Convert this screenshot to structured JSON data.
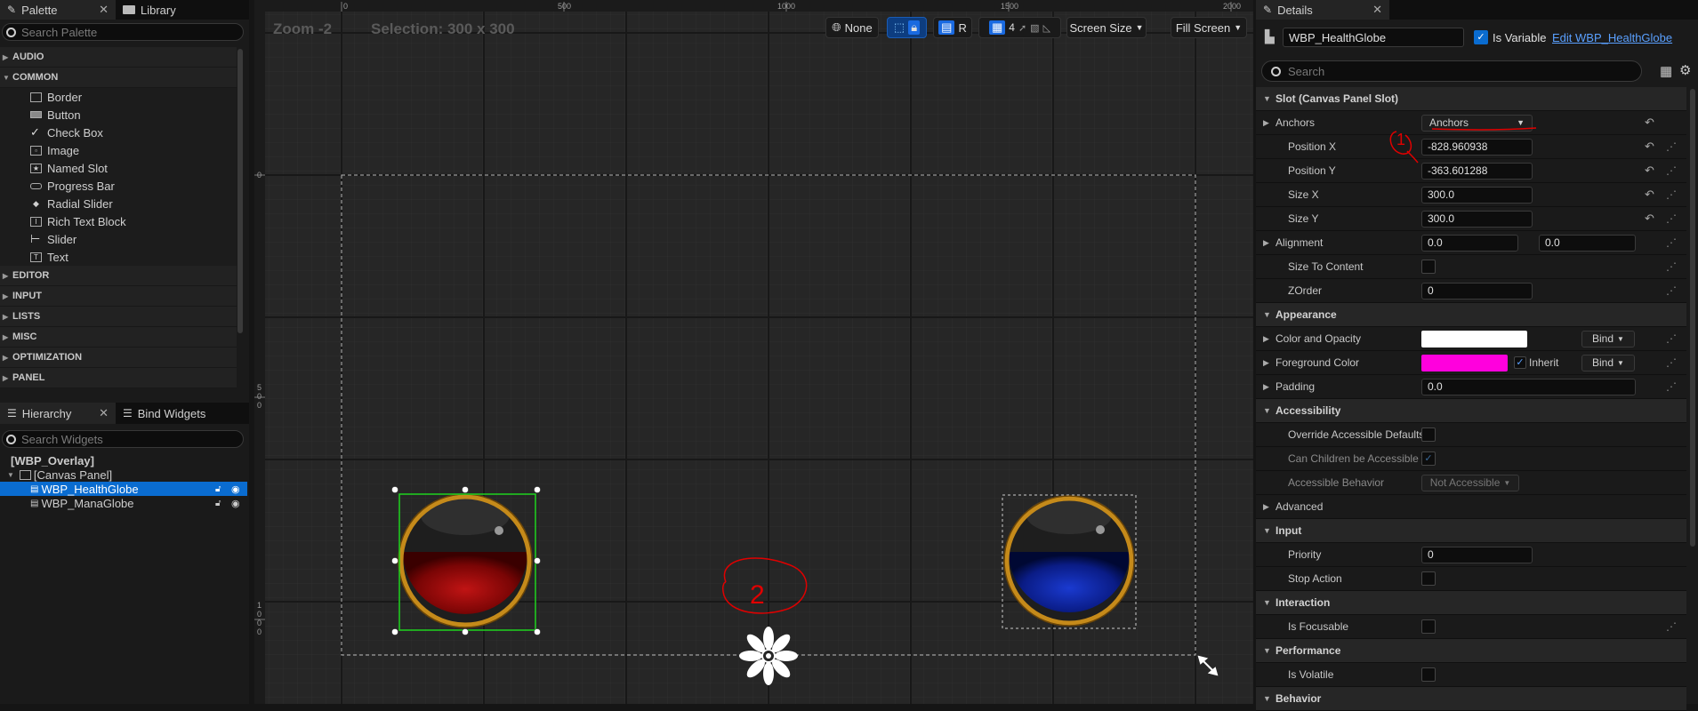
{
  "palette": {
    "tab_label": "Palette",
    "library_tab": "Library",
    "search_placeholder": "Search Palette",
    "categories_top": [
      "AUDIO",
      "COMMON"
    ],
    "common_items": [
      "Border",
      "Button",
      "Check Box",
      "Image",
      "Named Slot",
      "Progress Bar",
      "Radial Slider",
      "Rich Text Block",
      "Slider",
      "Text"
    ],
    "categories_bottom": [
      "EDITOR",
      "INPUT",
      "LISTS",
      "MISC",
      "OPTIMIZATION",
      "PANEL"
    ]
  },
  "hierarchy": {
    "tab_label": "Hierarchy",
    "bind_tab": "Bind Widgets",
    "search_placeholder": "Search Widgets",
    "root": "[WBP_Overlay]",
    "canvas": "[Canvas Panel]",
    "items": [
      "WBP_HealthGlobe",
      "WBP_ManaGlobe"
    ]
  },
  "viewport": {
    "zoom": "Zoom -2",
    "selection": "Selection: 300 x 300",
    "ruler_top": [
      "0",
      "500",
      "1000",
      "1500",
      "2000"
    ],
    "ruler_left": [
      "0",
      "5\n0\n0",
      "1\n0\n0\n0"
    ],
    "toolbar": {
      "none_label": "None",
      "r_label": "R",
      "grid_value": "4",
      "screen_size": "Screen Size",
      "fill_screen": "Fill Screen"
    },
    "annotation_2": "2",
    "health_color": "#8e0a0a",
    "mana_color": "#0a1f8c"
  },
  "details": {
    "tab_label": "Details",
    "widget_name": "WBP_HealthGlobe",
    "is_variable": "Is Variable",
    "edit_link": "Edit WBP_HealthGlobe",
    "search_placeholder": "Search",
    "annotation_1": "1",
    "sections": {
      "slot": "Slot (Canvas Panel Slot)",
      "appearance": "Appearance",
      "accessibility": "Accessibility",
      "advanced": "Advanced",
      "input": "Input",
      "interaction": "Interaction",
      "performance": "Performance",
      "behavior": "Behavior"
    },
    "anchors_label": "Anchors",
    "anchors_value": "Anchors",
    "position_x_label": "Position X",
    "position_x": "-828.960938",
    "position_y_label": "Position Y",
    "position_y": "-363.601288",
    "size_x_label": "Size X",
    "size_x": "300.0",
    "size_y_label": "Size Y",
    "size_y": "300.0",
    "alignment_label": "Alignment",
    "alignment_x": "0.0",
    "alignment_y": "0.0",
    "size_to_content": "Size To Content",
    "zorder_label": "ZOrder",
    "zorder": "0",
    "color_opacity": "Color and Opacity",
    "foreground_color": "Foreground Color",
    "inherit_label": "Inherit",
    "bind_label": "Bind",
    "padding_label": "Padding",
    "padding": "0.0",
    "override_accessible": "Override Accessible Defaults",
    "children_accessible": "Can Children be Accessible",
    "accessible_behavior": "Accessible Behavior",
    "not_accessible": "Not Accessible",
    "priority_label": "Priority",
    "priority": "0",
    "stop_action": "Stop Action",
    "is_focusable": "Is Focusable",
    "is_volatile": "Is Volatile",
    "color_opacity_swatch": "#ffffff",
    "foreground_swatch": "#ff00dd"
  }
}
